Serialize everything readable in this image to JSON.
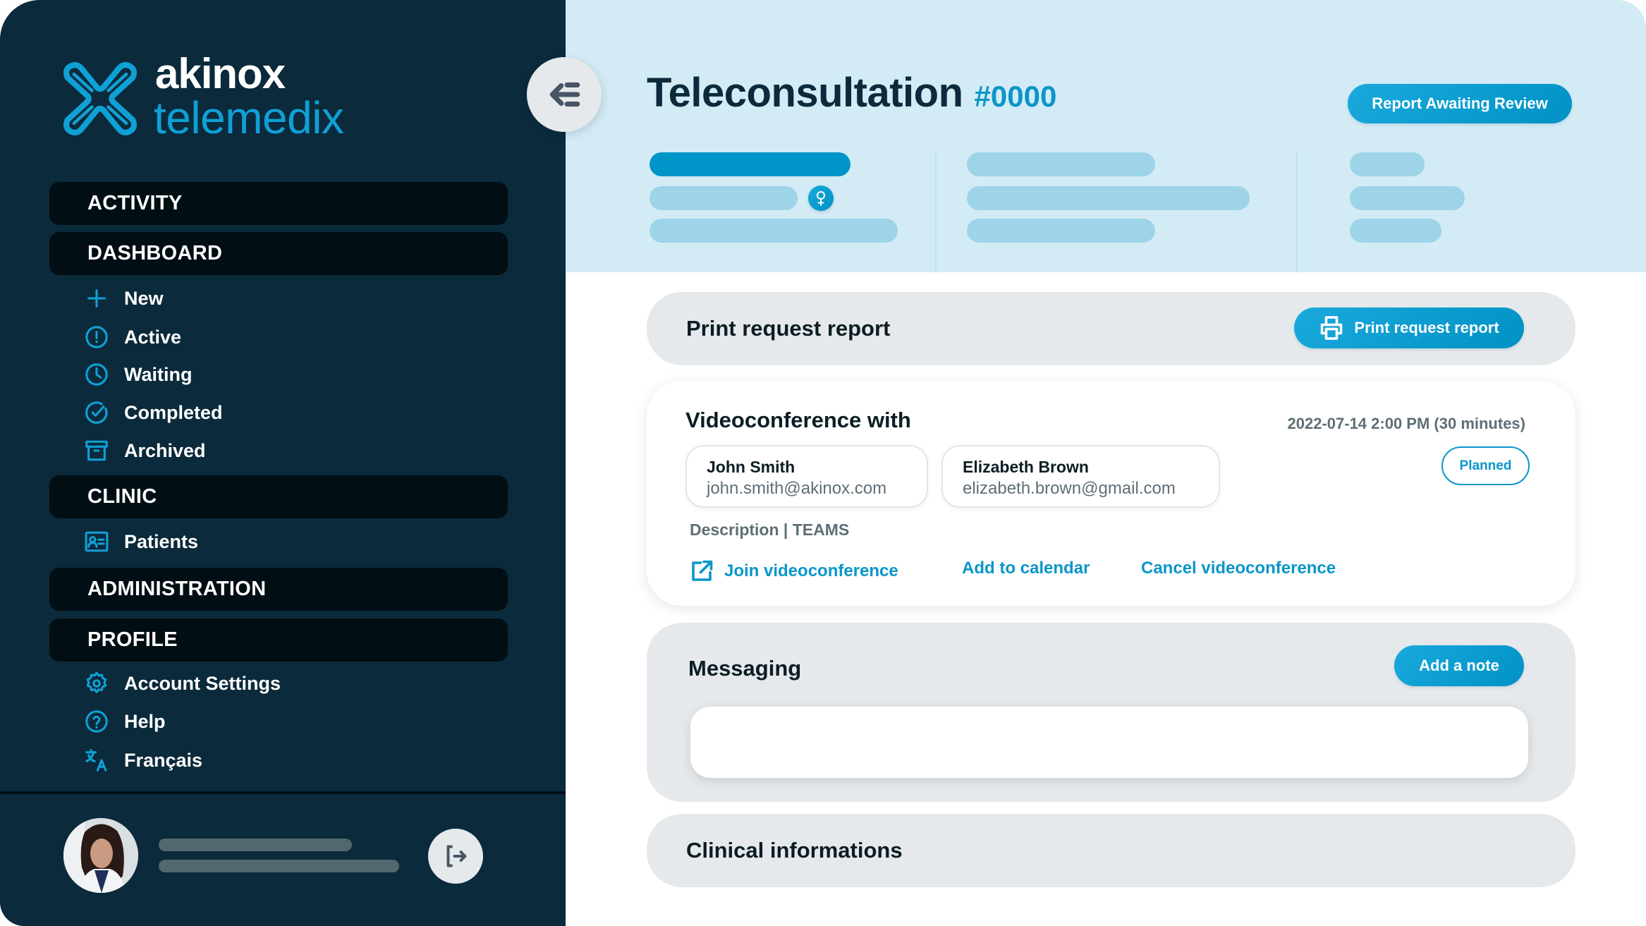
{
  "brand": {
    "name_top": "akinox",
    "name_bottom": "telemedix",
    "accent_color": "#0fa0d6"
  },
  "sidebar": {
    "sections": [
      {
        "label": "ACTIVITY",
        "items": []
      },
      {
        "label": "DASHBOARD",
        "items": [
          {
            "label": "New",
            "icon": "plus-icon"
          },
          {
            "label": "Active",
            "icon": "alert-circle-icon"
          },
          {
            "label": "Waiting",
            "icon": "clock-icon"
          },
          {
            "label": "Completed",
            "icon": "check-circle-icon"
          },
          {
            "label": "Archived",
            "icon": "archive-icon"
          }
        ]
      },
      {
        "label": "CLINIC",
        "items": [
          {
            "label": "Patients",
            "icon": "id-card-icon"
          }
        ]
      },
      {
        "label": "ADMINISTRATION",
        "items": []
      },
      {
        "label": "PROFILE",
        "items": [
          {
            "label": "Account Settings",
            "icon": "gear-icon"
          },
          {
            "label": "Help",
            "icon": "help-circle-icon"
          },
          {
            "label": "Français",
            "icon": "translate-icon"
          }
        ]
      }
    ],
    "user": {
      "avatar_icon": "user-avatar",
      "logout_icon": "logout-icon"
    }
  },
  "header": {
    "title": "Teleconsultation",
    "number": "#0000",
    "status_button": "Report Awaiting Review",
    "collapse_icon": "collapse-menu-icon",
    "gender_icon": "female-icon"
  },
  "print_card": {
    "title": "Print request report",
    "button": "Print request report",
    "button_icon": "printer-icon"
  },
  "video_card": {
    "title": "Videoconference with",
    "datetime": "2022-07-14 2:00 PM (30 minutes)",
    "status": "Planned",
    "participants": [
      {
        "name": "John Smith",
        "email": "john.smith@akinox.com"
      },
      {
        "name": "Elizabeth Brown",
        "email": "elizabeth.brown@gmail.com"
      }
    ],
    "description_label": "Description |",
    "description_value": "TEAMS",
    "links": {
      "join": "Join videoconference",
      "add_calendar": "Add to calendar",
      "cancel": "Cancel videoconference"
    }
  },
  "messaging_card": {
    "title": "Messaging",
    "button": "Add a note",
    "message_value": ""
  },
  "clinical_card": {
    "title": "Clinical informations"
  }
}
